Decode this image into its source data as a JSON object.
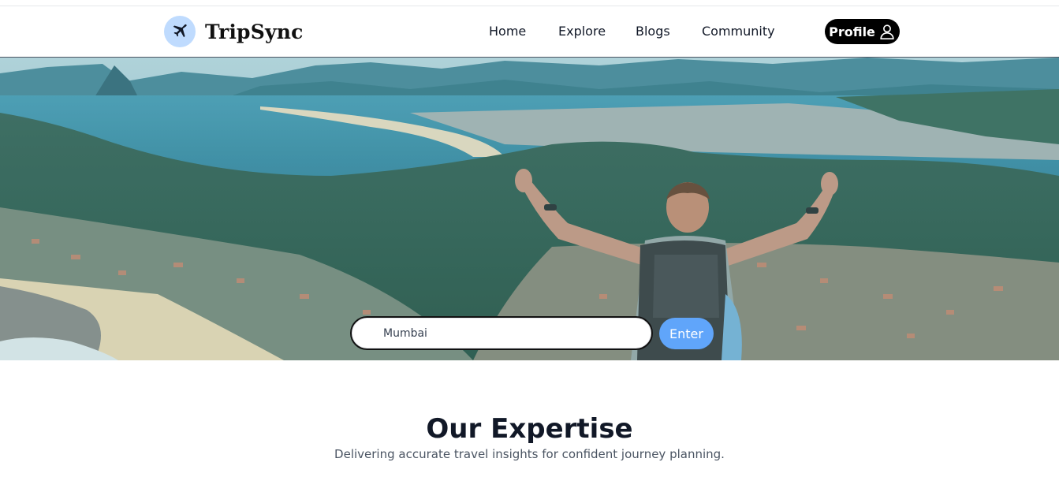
{
  "brand": {
    "name": "TripSync",
    "logo_icon": "airplane-icon",
    "logo_bg": "#bfdbfe"
  },
  "nav": {
    "links": [
      {
        "label": "Home"
      },
      {
        "label": "Explore"
      },
      {
        "label": "Blogs"
      },
      {
        "label": "Community"
      }
    ],
    "profile_label": "Profile",
    "profile_icon": "user-icon"
  },
  "hero": {
    "image": "traveler with raised arms overlooking coastal town and bay",
    "search": {
      "value": "Mumbai",
      "placeholder": ""
    },
    "enter_label": "Enter",
    "accent": "#60a5fa"
  },
  "expertise": {
    "title": "Our Expertise",
    "subtitle": "Delivering accurate travel insights for confident journey planning."
  }
}
